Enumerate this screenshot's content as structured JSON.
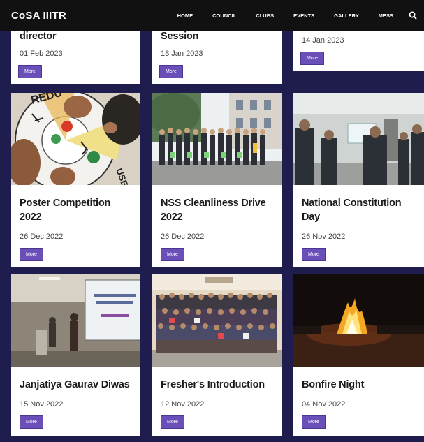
{
  "navbar": {
    "brand": "CoSA IIITR",
    "items": [
      "HOME",
      "COUNCIL",
      "CLUBS",
      "EVENTS",
      "GALLERY",
      "MESS"
    ],
    "search_icon": "search-icon"
  },
  "more_label": "More",
  "partial_cards": [
    {
      "title": "director",
      "date": "01 Feb 2023"
    },
    {
      "title": "Session",
      "date": "18 Jan 2023"
    },
    {
      "title": "",
      "date": "14 Jan 2023"
    }
  ],
  "cards": [
    {
      "title": "Poster Competition 2022",
      "date": "26 Dec 2022"
    },
    {
      "title": "NSS Cleanliness Drive 2022",
      "date": "26 Dec 2022"
    },
    {
      "title": "National Constitution Day",
      "date": "26 Nov 2022"
    },
    {
      "title": "Janjatiya Gaurav Diwas",
      "date": "15 Nov 2022"
    },
    {
      "title": "Fresher's Introduction",
      "date": "12 Nov 2022"
    },
    {
      "title": "Bonfire Night",
      "date": "04 Nov 2022"
    }
  ],
  "colors": {
    "background": "#1f1d4d",
    "navbar": "#111111",
    "button": "#6a4fb8"
  }
}
